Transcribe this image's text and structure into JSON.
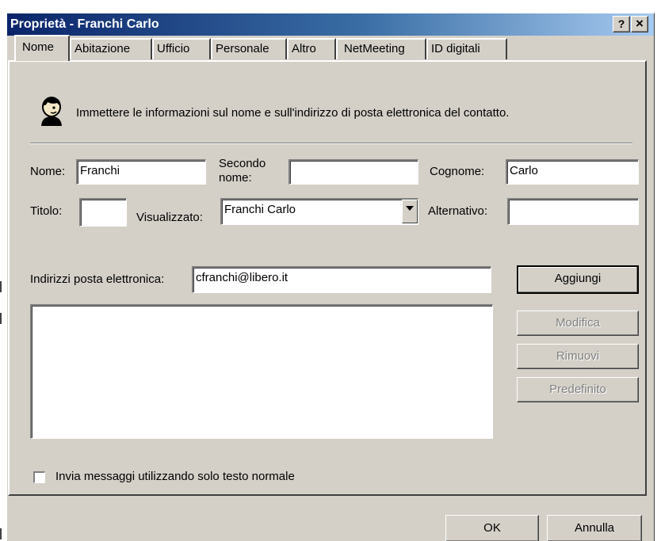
{
  "window": {
    "title": "Proprietà - Franchi Carlo",
    "help_button": "?",
    "close_button": "×"
  },
  "tabs": [
    {
      "label": "Nome",
      "active": true
    },
    {
      "label": "Abitazione"
    },
    {
      "label": "Ufficio"
    },
    {
      "label": "Personale"
    },
    {
      "label": "Altro"
    },
    {
      "label": "NetMeeting"
    },
    {
      "label": "ID digitali"
    }
  ],
  "intro": {
    "icon": "contact-person-icon",
    "text": "Immettere le informazioni sul nome e sull'indirizzo di posta elettronica del contatto."
  },
  "name_fields": {
    "nome_label": "Nome:",
    "nome_value": "Franchi",
    "secondo_label_1": "Secondo",
    "secondo_label_2": "nome:",
    "secondo_value": "",
    "cognome_label": "Cognome:",
    "cognome_value": "Carlo",
    "titolo_label": "Titolo:",
    "titolo_value": "",
    "visualizzato_label": "Visualizzato:",
    "visualizzato_value": "Franchi Carlo",
    "alternativo_label": "Alternativo:",
    "alternativo_value": ""
  },
  "email": {
    "label": "Indirizzi posta elettronica:",
    "value": "cfranchi@libero.it",
    "list_items": [],
    "aggiungi": "Aggiungi",
    "modifica": "Modifica",
    "rimuovi": "Rimuovi",
    "predefinito": "Predefinito"
  },
  "plain_text": {
    "label": "Invia messaggi utilizzando solo testo normale",
    "checked": false
  },
  "footer": {
    "ok": "OK",
    "annulla": "Annulla"
  }
}
